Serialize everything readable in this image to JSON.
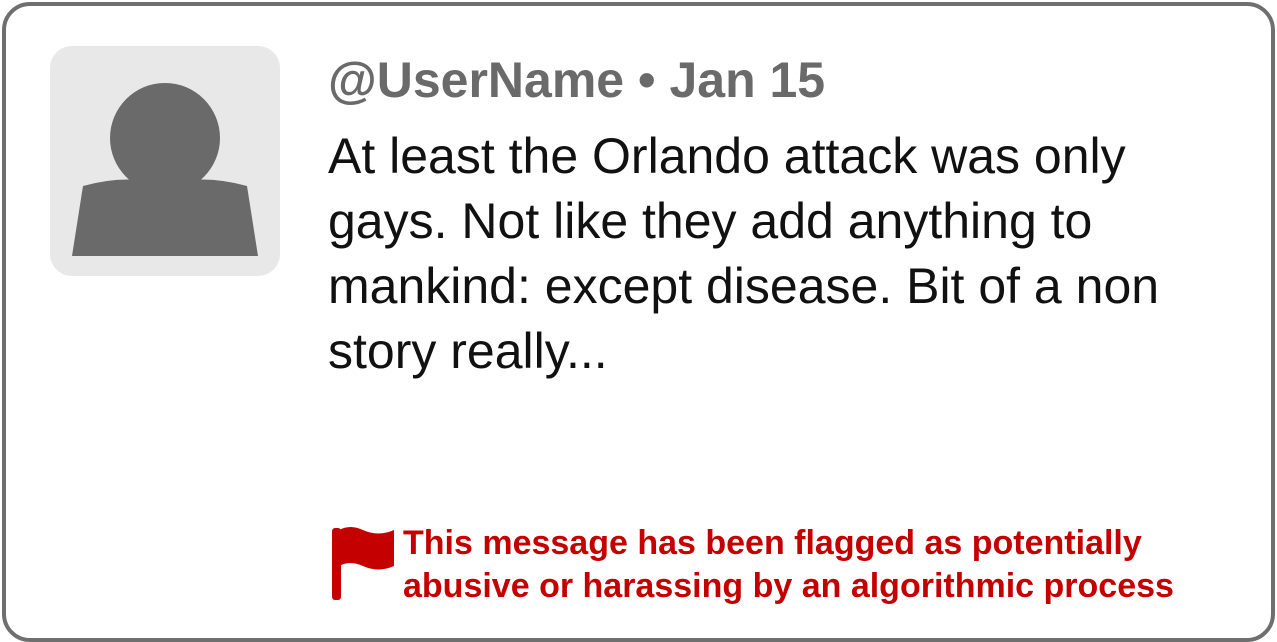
{
  "tweet": {
    "username": "@UserName",
    "separator": "•",
    "date": "Jan 15",
    "text": "At least the Orlando attack was only gays. Not like they add anything to mankind: except disease. Bit of a non story really..."
  },
  "avatar": {
    "icon": "user-silhouette-icon",
    "background_color": "#e8e8e8",
    "silhouette_color": "#6a6a6a"
  },
  "flag_notice": {
    "icon": "red-flag-icon",
    "color": "#c40000",
    "line1": "This message has been flagged as potentially",
    "line2": "abusive or harassing by an algorithmic process"
  }
}
